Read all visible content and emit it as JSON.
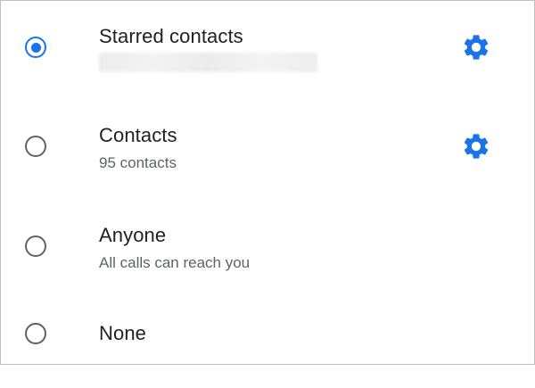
{
  "options": [
    {
      "label": "Starred contacts",
      "subtitle": "",
      "selected": true,
      "has_settings": true
    },
    {
      "label": "Contacts",
      "subtitle": "95 contacts",
      "selected": false,
      "has_settings": true
    },
    {
      "label": "Anyone",
      "subtitle": "All calls can reach you",
      "selected": false,
      "has_settings": false
    },
    {
      "label": "None",
      "subtitle": "",
      "selected": false,
      "has_settings": false
    }
  ],
  "colors": {
    "accent": "#1a73e8",
    "radio_unchecked": "#616161",
    "title_text": "#202124",
    "subtitle_text": "#5f6368"
  },
  "icons": {
    "settings": "gear-icon"
  }
}
